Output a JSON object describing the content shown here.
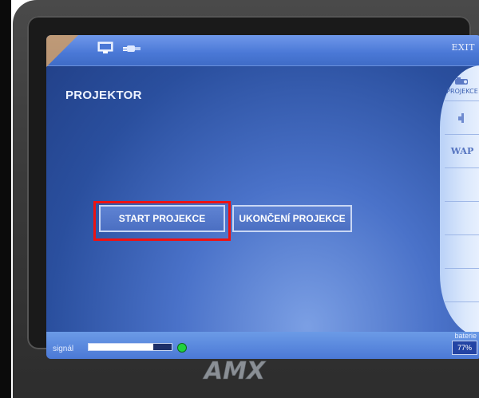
{
  "header": {
    "exit_label": "EXIT",
    "icons": [
      "monitor-icon",
      "plug-icon"
    ]
  },
  "page": {
    "title": "PROJEKTOR"
  },
  "right_panel": {
    "projector_label": "PROJEKCE",
    "wap_label": "WAP",
    "icons": [
      "projector-icon",
      "speaker-icon"
    ]
  },
  "buttons": {
    "start_label": "START PROJEKCE",
    "end_label": "UKONČENÍ PROJEKCE"
  },
  "status": {
    "signal_label": "signál",
    "signal_level": 0.78,
    "battery_label": "baterie",
    "battery_value": "77%"
  },
  "brand": "AMX",
  "colors": {
    "screen_blue": "#2a4f9e",
    "highlight_red": "#ee1212",
    "signal_green": "#20d23f"
  }
}
